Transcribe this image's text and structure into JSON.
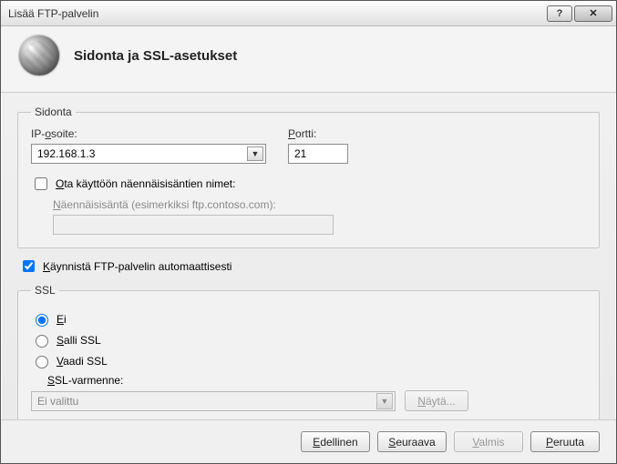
{
  "window": {
    "title": "Lisää FTP-palvelin"
  },
  "header": {
    "heading": "Sidonta ja SSL-asetukset"
  },
  "binding": {
    "legend": "Sidonta",
    "ip_label": "IP-osoite:",
    "ip_value": "192.168.1.3",
    "port_label": "Portti:",
    "port_value": "21",
    "enable_virtual_label": "Ota käyttöön näennäisisäntien nimet:",
    "enable_virtual_checked": false,
    "virtual_label": "Näennäisisäntä (esimerkiksi ftp.contoso.com):",
    "virtual_value": ""
  },
  "autostart": {
    "label": "Käynnistä FTP-palvelin automaattisesti",
    "checked": true
  },
  "ssl": {
    "legend": "SSL",
    "options": {
      "none": "Ei",
      "allow": "Salli SSL",
      "require": "Vaadi SSL"
    },
    "selected": "none",
    "cert_label": "SSL-varmenne:",
    "cert_value": "Ei valittu",
    "show_button": "Näytä..."
  },
  "footer": {
    "prev": "Edellinen",
    "next": "Seuraava",
    "finish": "Valmis",
    "cancel": "Peruuta"
  },
  "underline_map": {
    "ip_label": 3,
    "port_label": 0,
    "enable_virtual_label": 0,
    "virtual_label": 0,
    "autostart": 0,
    "ssl_none": 0,
    "ssl_allow": 0,
    "ssl_require": 0,
    "cert_label": 0,
    "show_button": 0,
    "prev": 0,
    "next": 0,
    "finish": 0,
    "cancel": 0
  }
}
